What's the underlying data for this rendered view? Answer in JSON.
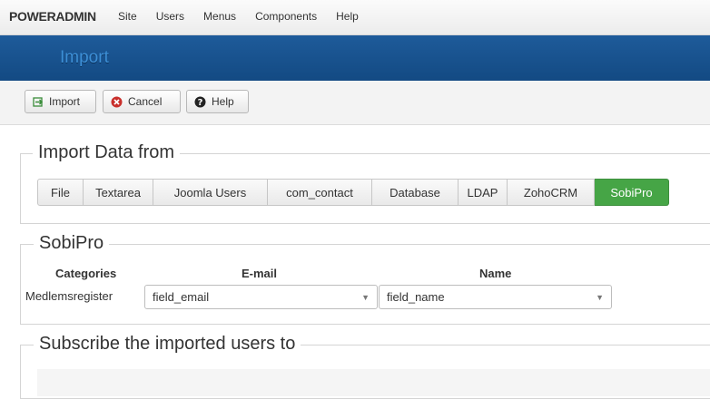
{
  "app": {
    "logo_power": "POWER",
    "logo_admin": "ADMIN"
  },
  "menu": [
    {
      "label": "Site"
    },
    {
      "label": "Users"
    },
    {
      "label": "Menus"
    },
    {
      "label": "Components"
    },
    {
      "label": "Help"
    }
  ],
  "page": {
    "title": "Import"
  },
  "toolbar": {
    "import_label": "Import",
    "cancel_label": "Cancel",
    "help_label": "Help",
    "import_icon": "import-icon",
    "cancel_icon": "cancel-icon",
    "help_icon": "help-icon"
  },
  "import_from": {
    "legend": "Import Data from",
    "tabs": [
      {
        "label": "File"
      },
      {
        "label": "Textarea"
      },
      {
        "label": "Joomla Users"
      },
      {
        "label": "com_contact"
      },
      {
        "label": "Database"
      },
      {
        "label": "LDAP"
      },
      {
        "label": "ZohoCRM"
      },
      {
        "label": "SobiPro",
        "active": true
      }
    ],
    "active_color": "#46a546"
  },
  "sobipro": {
    "legend": "SobiPro",
    "headers": {
      "categories": "Categories",
      "email": "E-mail",
      "name": "Name"
    },
    "category_value": "Medlemsregister",
    "email_select": "field_email",
    "name_select": "field_name"
  },
  "subscribe": {
    "legend": "Subscribe the imported users to"
  },
  "colors": {
    "title_bar": "#1a548f",
    "title_text": "#3d8fd6"
  }
}
